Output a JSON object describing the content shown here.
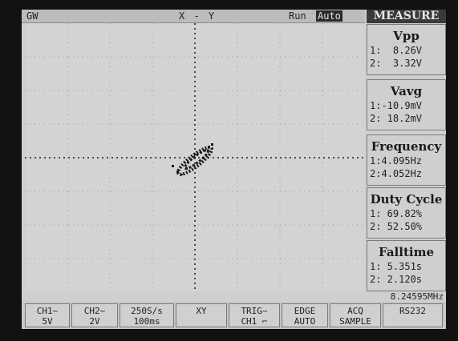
{
  "topbar": {
    "channel": "GW",
    "mode": "X - Y",
    "run_status": "Run",
    "trigger_mode": "Auto"
  },
  "measure": {
    "title": "MEASURE",
    "boxes": [
      {
        "name": "Vpp",
        "ch1": "1:  8.26V",
        "ch2": "2:  3.32V"
      },
      {
        "name": "Vavg",
        "ch1": "1:-10.9mV",
        "ch2": "2: 18.2mV"
      },
      {
        "name": "Frequency",
        "ch1": "1:4.095Hz",
        "ch2": "2:4.052Hz"
      },
      {
        "name": "Duty Cycle",
        "ch1": "1: 69.82%",
        "ch2": "2: 52.50%"
      },
      {
        "name": "Falltime",
        "ch1": "1: 5.351s",
        "ch2": "2: 2.120s"
      }
    ]
  },
  "frequency_readout": "8.24595MHz",
  "softkeys": [
    {
      "l1": "CH1~",
      "l2": "5V"
    },
    {
      "l1": "CH2~",
      "l2": "2V"
    },
    {
      "l1": "250S/s",
      "l2": "100ms"
    },
    {
      "l1": "XY",
      "l2": ""
    },
    {
      "l1": "TRIG~",
      "l2": "CH1 ⌐"
    },
    {
      "l1": "EDGE",
      "l2": "AUTO"
    },
    {
      "l1": "ACQ",
      "l2": "SAMPLE"
    },
    {
      "l1": "RS232",
      "l2": ""
    }
  ],
  "colors": {
    "screen": "#cfcfcf",
    "trace": "#1a1a1a",
    "measure_header": "#3a3a3a"
  }
}
